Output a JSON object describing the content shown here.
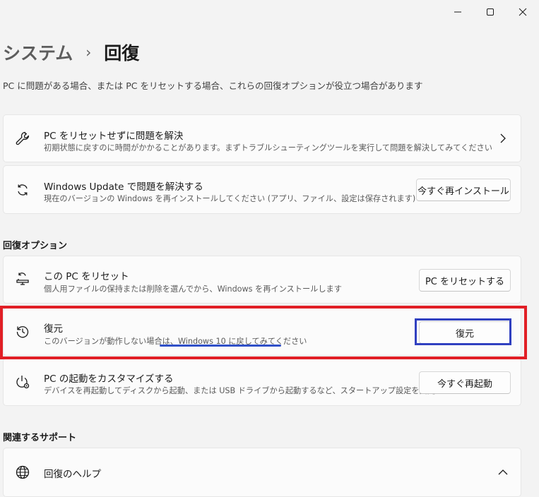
{
  "window_controls": {
    "minimize_icon": "minimize-icon",
    "maximize_icon": "maximize-icon",
    "close_icon": "close-icon"
  },
  "breadcrumb": {
    "parent": "システム",
    "separator": "›",
    "current": "回復"
  },
  "description": "PC に問題がある場合、または PC をリセットする場合、これらの回復オプションが役立つ場合があります",
  "fix_cards": [
    {
      "icon": "wrench-icon",
      "title": "PC をリセットせずに問題を解決",
      "subtitle": "初期状態に戻すのに時間がかかることがあります。まずトラブルシューティングツールを実行して問題を解決してみてください"
    },
    {
      "icon": "refresh-icon",
      "title": "Windows Update で問題を解決する",
      "subtitle": "現在のバージョンの Windows を再インストールしてください (アプリ、ファイル、設定は保存されます)",
      "button": "今すぐ再インストール"
    }
  ],
  "recovery_options": {
    "heading": "回復オプション",
    "items": [
      {
        "icon": "reset-pc-icon",
        "title": "この PC をリセット",
        "subtitle": "個人用ファイルの保持または削除を選んでから、Windows を再インストールします",
        "button": "PC をリセットする"
      },
      {
        "icon": "history-icon",
        "title": "復元",
        "subtitle_prefix": "このバージョンが動作しない場合は、",
        "subtitle_highlight": "Windows 10 に戻してみてください",
        "button": "復元"
      },
      {
        "icon": "advanced-startup-icon",
        "title": "PC の起動をカスタマイズする",
        "subtitle": "デバイスを再起動してディスクから起動、または USB ドライブから起動するなど、スタートアップ設定を変更する",
        "button": "今すぐ再起動"
      }
    ]
  },
  "related_support": {
    "heading": "関連するサポート",
    "help_title": "回復のヘルプ",
    "help_icon": "globe-icon"
  },
  "annotation_colors": {
    "red_box": "#e11f26",
    "blue_box": "#3040c0",
    "underline": "#3050c8"
  }
}
